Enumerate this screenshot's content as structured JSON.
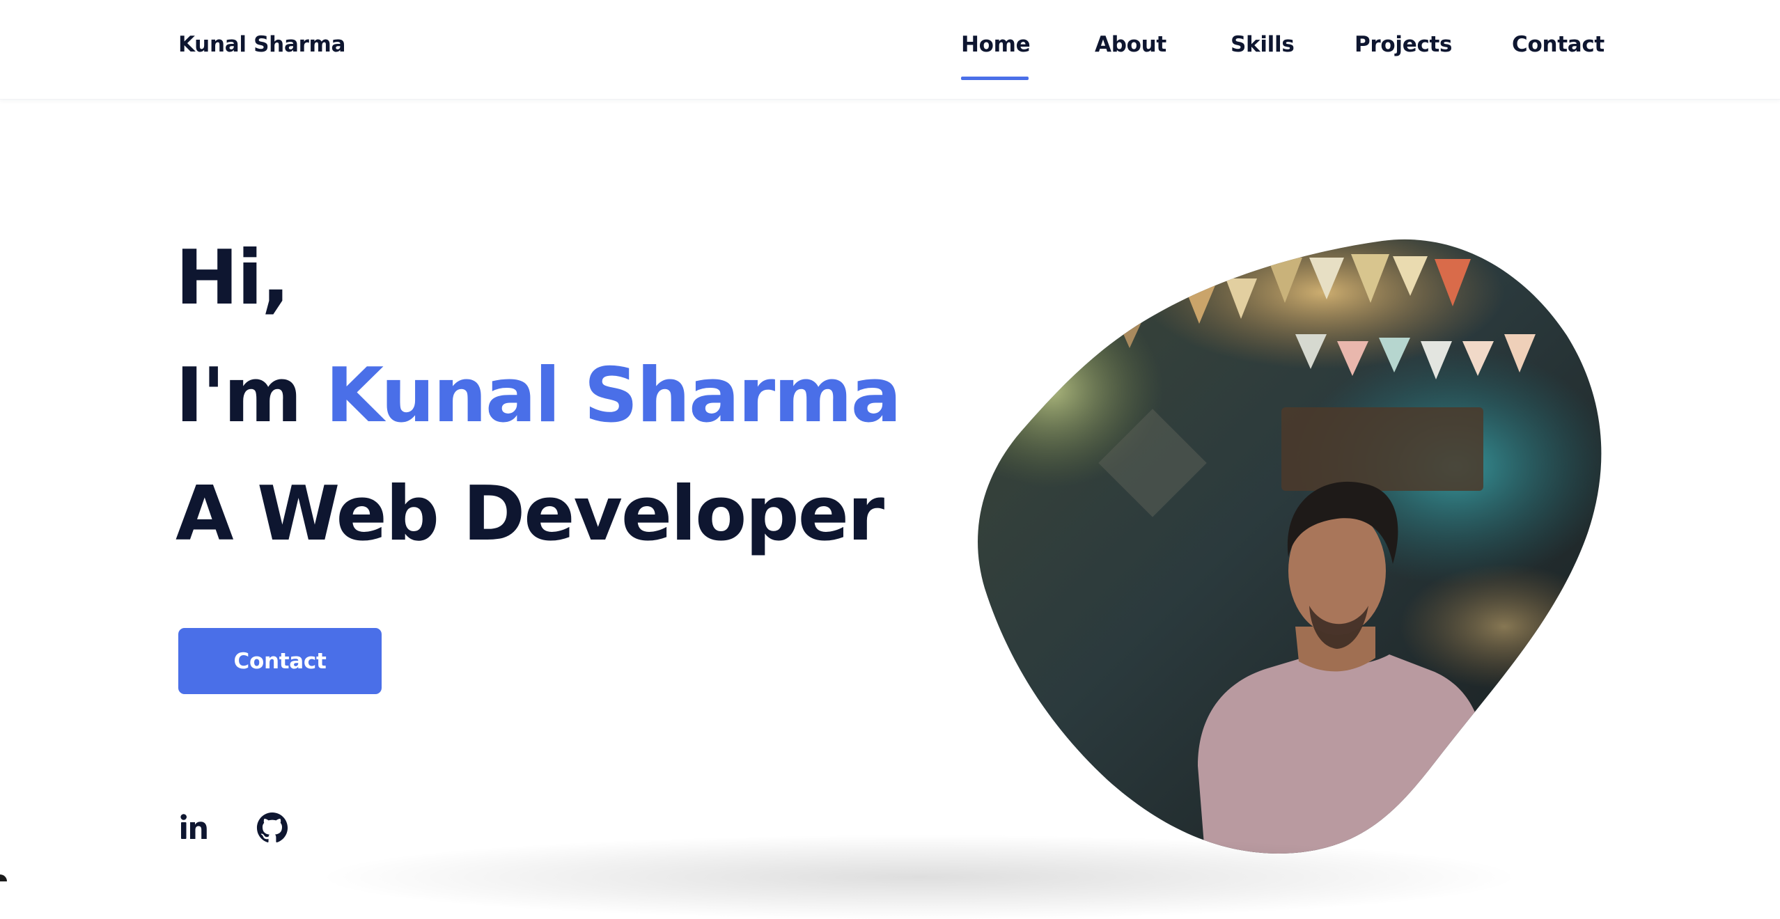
{
  "header": {
    "logo": "Kunal Sharma",
    "nav": [
      {
        "label": "Home",
        "active": true
      },
      {
        "label": "About",
        "active": false
      },
      {
        "label": "Skills",
        "active": false
      },
      {
        "label": "Projects",
        "active": false
      },
      {
        "label": "Contact",
        "active": false
      }
    ]
  },
  "hero": {
    "greeting": "Hi,",
    "intro_prefix": "I'm ",
    "name": "Kunal Sharma",
    "role": "A Web Developer",
    "cta_label": "Contact"
  },
  "social": {
    "icons": [
      "linkedin-icon",
      "github-icon"
    ]
  },
  "colors": {
    "accent": "#4a6fe8",
    "text_dark": "#0e1630",
    "background": "#ffffff"
  }
}
